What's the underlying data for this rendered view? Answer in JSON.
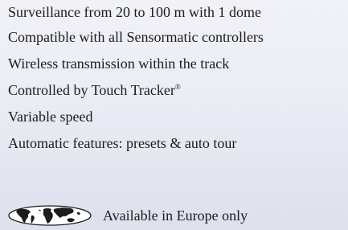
{
  "features": [
    {
      "text": "Surveillance from 20 to 100 m with 1 dome"
    },
    {
      "text": "Compatible with all Sensormatic controllers"
    },
    {
      "text": "Wireless transmission within the track"
    },
    {
      "text": "Controlled by Touch Tracker",
      "mark": "®"
    },
    {
      "text": "Variable speed"
    },
    {
      "text": "Automatic features: presets & auto tour"
    }
  ],
  "availability": {
    "icon": "world-map-icon",
    "text": "Available in Europe only"
  },
  "colors": {
    "text": "#1c1c1c",
    "background_top": "#f1f2f8",
    "background_bottom": "#dde1ec"
  }
}
